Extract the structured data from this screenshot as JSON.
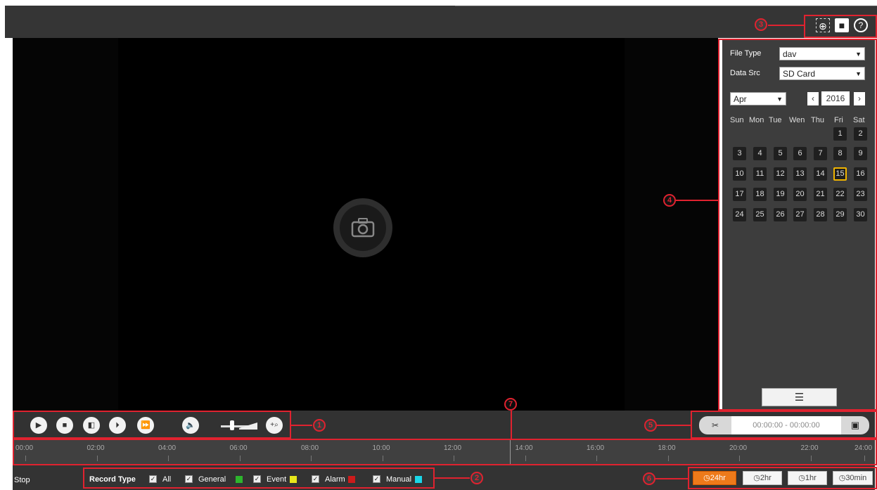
{
  "sidebar": {
    "file_type_label": "File Type",
    "file_type_value": "dav",
    "data_src_label": "Data Src",
    "data_src_value": "SD Card",
    "month_value": "Apr",
    "year_value": "2016",
    "weekdays": [
      "Sun",
      "Mon",
      "Tue",
      "Wen",
      "Thu",
      "Fri",
      "Sat"
    ],
    "days": [
      "1",
      "2",
      "3",
      "4",
      "5",
      "6",
      "7",
      "8",
      "9",
      "10",
      "11",
      "12",
      "13",
      "14",
      "15",
      "16",
      "17",
      "18",
      "19",
      "20",
      "21",
      "22",
      "23",
      "24",
      "25",
      "26",
      "27",
      "28",
      "29",
      "30"
    ],
    "selected_day": "15"
  },
  "controls": {
    "time_range": "00:00:00 - 00:00:00",
    "volume_level": 0.35
  },
  "timeline": {
    "ticks": [
      "00:00",
      "02:00",
      "04:00",
      "06:00",
      "08:00",
      "10:00",
      "12:00",
      "14:00",
      "16:00",
      "18:00",
      "20:00",
      "22:00",
      "24:00"
    ]
  },
  "bottom": {
    "status": "Stop",
    "record_type_label": "Record Type",
    "types": [
      {
        "label": "All",
        "color": ""
      },
      {
        "label": "General",
        "color": "#2db52d"
      },
      {
        "label": "Event",
        "color": "#e8e81a"
      },
      {
        "label": "Alarm",
        "color": "#cc1b1b"
      },
      {
        "label": "Manual",
        "color": "#1ad6e8"
      }
    ],
    "ranges": [
      "24hr",
      "2hr",
      "1hr",
      "30min"
    ],
    "active_range": "24hr"
  },
  "callouts": [
    "1",
    "2",
    "3",
    "4",
    "5",
    "6",
    "7"
  ],
  "colors": {
    "accent": "#ee7a1a",
    "annotation": "#e0222f",
    "selected_day_border": "#f0b400"
  }
}
